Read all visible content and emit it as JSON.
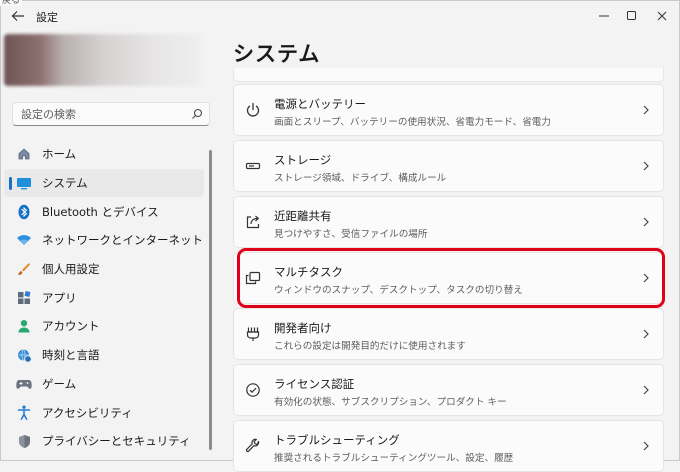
{
  "window": {
    "title": "設定",
    "tooltip_fragment": "戻る"
  },
  "search": {
    "placeholder": "設定の検索"
  },
  "sidebar": {
    "items": [
      {
        "label": "ホーム",
        "icon": "home-icon"
      },
      {
        "label": "システム",
        "icon": "display-icon",
        "selected": true
      },
      {
        "label": "Bluetooth とデバイス",
        "icon": "bluetooth-icon"
      },
      {
        "label": "ネットワークとインターネット",
        "icon": "wifi-icon"
      },
      {
        "label": "個人用設定",
        "icon": "brush-icon"
      },
      {
        "label": "アプリ",
        "icon": "apps-icon"
      },
      {
        "label": "アカウント",
        "icon": "person-icon"
      },
      {
        "label": "時刻と言語",
        "icon": "globe-clock-icon"
      },
      {
        "label": "ゲーム",
        "icon": "gamepad-icon"
      },
      {
        "label": "アクセシビリティ",
        "icon": "accessibility-icon"
      },
      {
        "label": "プライバシーとセキュリティ",
        "icon": "shield-icon"
      }
    ]
  },
  "main": {
    "title": "システム",
    "cards": [
      {
        "title": "電源とバッテリー",
        "description": "画面とスリープ、バッテリーの使用状況、省電力モード、省電力",
        "icon": "power-icon"
      },
      {
        "title": "ストレージ",
        "description": "ストレージ領域、ドライブ、構成ルール",
        "icon": "storage-icon"
      },
      {
        "title": "近距離共有",
        "description": "見つけやすさ、受信ファイルの場所",
        "icon": "share-icon"
      },
      {
        "title": "マルチタスク",
        "description": "ウィンドウのスナップ、デスクトップ、タスクの切り替え",
        "icon": "multitask-icon",
        "highlighted": true
      },
      {
        "title": "開発者向け",
        "description": "これらの設定は開発目的だけに使用されます",
        "icon": "developer-icon"
      },
      {
        "title": "ライセンス認証",
        "description": "有効化の状態、サブスクリプション、プロダクト キー",
        "icon": "activation-icon"
      },
      {
        "title": "トラブルシューティング",
        "description": "推奨されるトラブルシューティングツール、設定、履歴",
        "icon": "wrench-icon"
      }
    ]
  },
  "colors": {
    "accent": "#1f6fc5",
    "highlight_box": "#e0001b",
    "background": "#f3f3f3",
    "card": "#fbfbfb"
  }
}
